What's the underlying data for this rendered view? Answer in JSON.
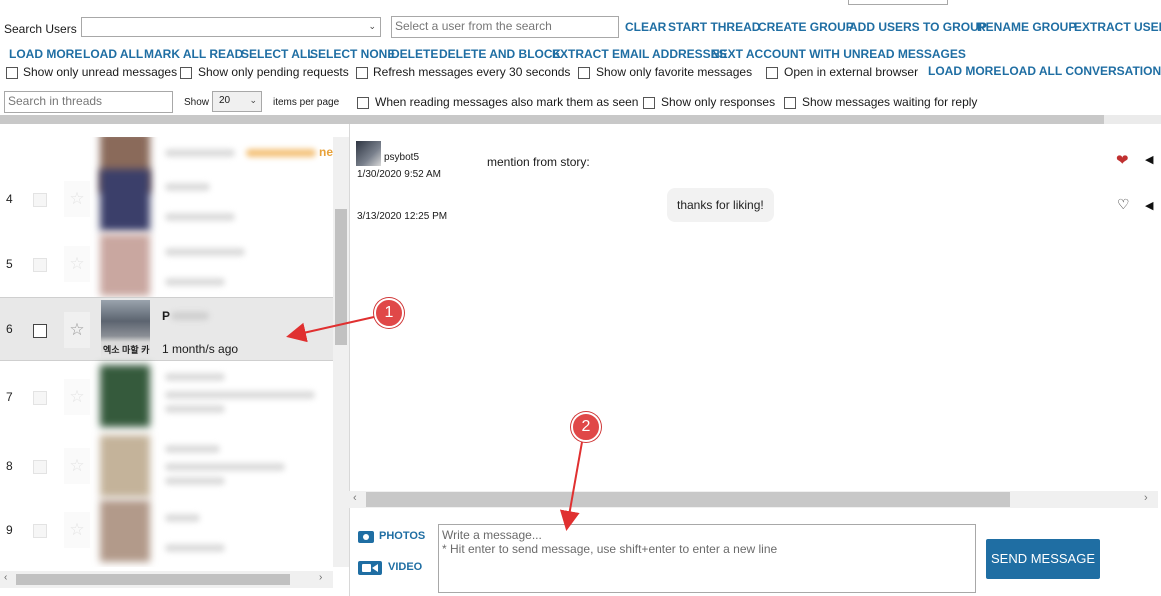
{
  "toolbar": {
    "search_users_label": "Search Users",
    "user_search_placeholder": "Select a user from the search",
    "row1_links": [
      "CLEAR",
      "START THREAD",
      "CREATE GROUP",
      "ADD USERS TO GROUP",
      "RENAME GROUP",
      "EXTRACT USERI"
    ],
    "row2_links": [
      "LOAD MORE",
      "LOAD ALL",
      "MARK ALL READ",
      "SELECT ALL",
      "SELECT NONE",
      "DELETE",
      "DELETE AND BLOCK",
      "EXTRACT EMAIL ADDRESSES",
      "NEXT ACCOUNT WITH UNREAD MESSAGES"
    ],
    "row3_options": [
      "Show only unread messages",
      "Show only pending requests",
      "Refresh messages every 30 seconds",
      "Show only favorite messages",
      "Open in external browser"
    ],
    "row3_links": [
      "LOAD MORE",
      "LOAD ALL CONVERSATION"
    ],
    "threads_search_placeholder": "Search in threads",
    "show_label": "Show",
    "per_page_value": "20",
    "per_page_label": "items per page",
    "row4_options": [
      "When reading messages also mark them as seen",
      "Show only responses",
      "Show messages waiting for reply"
    ]
  },
  "threads": {
    "rows": [
      {
        "num": "",
        "name": "",
        "time": ""
      },
      {
        "num": "4",
        "name": "",
        "time": ""
      },
      {
        "num": "5",
        "name": "",
        "time": ""
      },
      {
        "num": "6",
        "name": "P",
        "time": "1 month/s ago"
      },
      {
        "num": "7",
        "name": "",
        "time": ""
      },
      {
        "num": "8",
        "name": "",
        "time": ""
      },
      {
        "num": "9",
        "name": "",
        "time": ""
      }
    ],
    "partial_badge_text": "ne",
    "avatar_caption": "엑소 마할 카"
  },
  "conversation": {
    "sender": "psybot5",
    "message1_date": "1/30/2020 9:52 AM",
    "message1_text": "mention from story:",
    "message2_date": "3/13/2020 12:25 PM",
    "message2_text": "thanks for liking!"
  },
  "composer": {
    "photos_label": "PHOTOS",
    "video_label": "VIDEO",
    "placeholder_line1": "Write a message...",
    "placeholder_line2": "* Hit enter to send message, use shift+enter to enter a new line",
    "send_label": "SEND MESSAGE"
  },
  "annotations": [
    "1",
    "2"
  ],
  "colors": {
    "link": "#1f6ea3",
    "send_button": "#1f6ea3",
    "annotation": "#e04848",
    "heart": "#c03030"
  },
  "icons": [
    "chevron-down-icon",
    "star-icon",
    "heart-filled-icon",
    "heart-outline-icon",
    "camera-icon",
    "video-camera-icon",
    "caret-left-icon"
  ]
}
